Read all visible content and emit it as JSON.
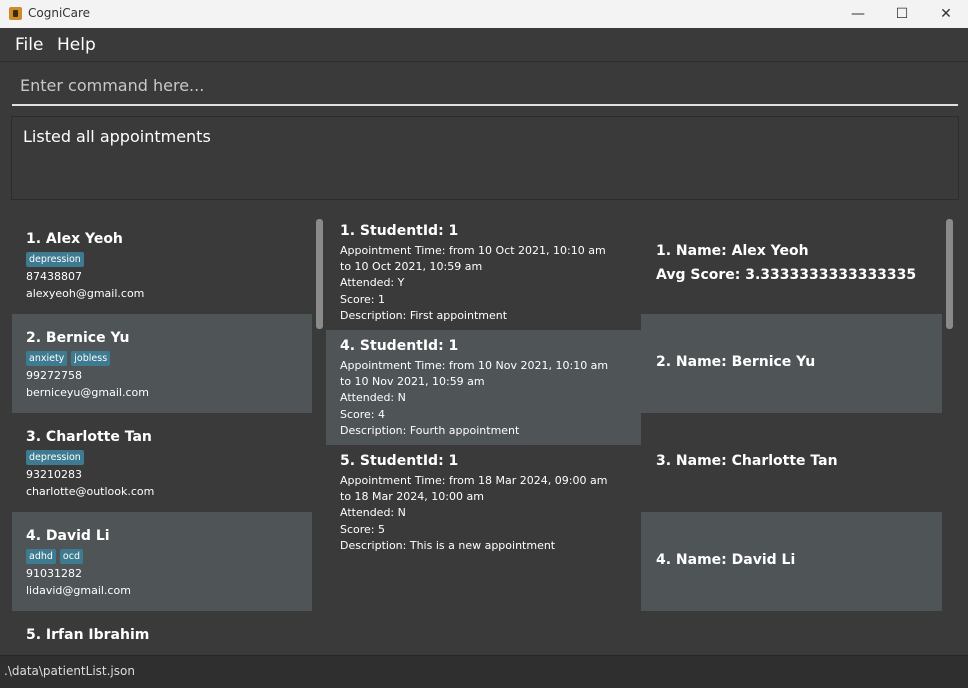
{
  "window": {
    "title": "CogniCare",
    "minimize": "—",
    "maximize": "☐",
    "close": "✕"
  },
  "menu": {
    "file": "File",
    "help": "Help"
  },
  "command": {
    "placeholder": "Enter command here...",
    "value": ""
  },
  "result": {
    "text": "Listed all appointments"
  },
  "patients": [
    {
      "name": "1.  Alex Yeoh",
      "tags": [
        "depression"
      ],
      "phone": "87438807",
      "email": "alexyeoh@gmail.com"
    },
    {
      "name": "2.  Bernice Yu",
      "tags": [
        "anxiety",
        "jobless"
      ],
      "phone": "99272758",
      "email": "berniceyu@gmail.com"
    },
    {
      "name": "3.  Charlotte Tan",
      "tags": [
        "depression"
      ],
      "phone": "93210283",
      "email": "charlotte@outlook.com"
    },
    {
      "name": "4.  David Li",
      "tags": [
        "adhd",
        "ocd"
      ],
      "phone": "91031282",
      "email": "lidavid@gmail.com"
    },
    {
      "name": "5.  Irfan Ibrahim"
    }
  ],
  "appointments": [
    {
      "header": "1.  StudentId: 1",
      "time": "Appointment Time: from 10 Oct 2021, 10:10 am",
      "time_to": "to 10 Oct 2021, 10:59 am",
      "attended": "Attended: Y",
      "score": "Score: 1",
      "description": "Description: First appointment"
    },
    {
      "header": "4.  StudentId: 1",
      "time": "Appointment Time: from 10 Nov 2021, 10:10 am",
      "time_to": "to 10 Nov 2021, 10:59 am",
      "attended": "Attended: N",
      "score": "Score: 4",
      "description": "Description: Fourth appointment"
    },
    {
      "header": "5.  StudentId: 1",
      "time": "Appointment Time: from 18 Mar 2024, 09:00 am",
      "time_to": "to 18 Mar 2024, 10:00 am",
      "attended": "Attended: N",
      "score": "Score: 5",
      "description": "Description: This is a new appointment"
    }
  ],
  "scores": [
    {
      "name": "1.  Name: Alex Yeoh",
      "avg": "Avg Score: 3.3333333333333335"
    },
    {
      "name": "2.  Name: Bernice Yu"
    },
    {
      "name": "3.  Name: Charlotte Tan"
    },
    {
      "name": "4.  Name: David Li"
    }
  ],
  "status": {
    "path": ".\\data\\patientList.json"
  }
}
